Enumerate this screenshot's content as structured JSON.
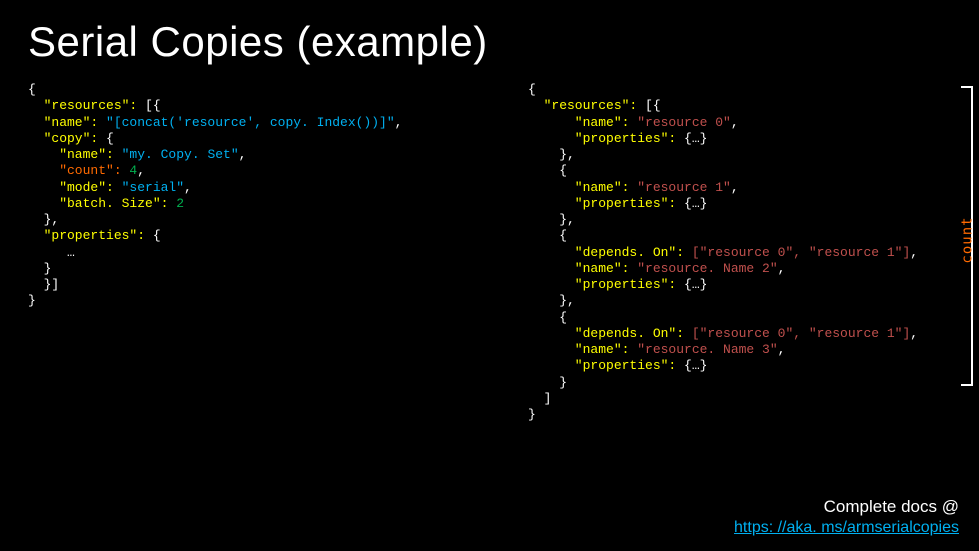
{
  "slide": {
    "title": "Serial Copies  (example)"
  },
  "code_left": {
    "l0": "{",
    "l1a": "  \"resources\": ",
    "l1b": "[{",
    "l2a": "  \"name\": ",
    "l2b": "\"[concat('resource', copy. Index())]\"",
    "l2c": ",",
    "l3a": "  \"copy\": ",
    "l3b": "{",
    "l4a": "    \"name\": ",
    "l4b": "\"my. Copy. Set\"",
    "l4c": ",",
    "l5a": "    \"count\": ",
    "l5b": "4",
    "l5c": ",",
    "l6a": "    \"mode\": ",
    "l6b": "\"serial\"",
    "l6c": ",",
    "l7a": "    \"batch. Size\": ",
    "l7b": "2",
    "l8": "  },",
    "l9a": "  \"properties\": ",
    "l9b": "{",
    "l10": "     …",
    "l11": "  }",
    "l12": "  }]",
    "l13": "}"
  },
  "code_right": {
    "l0": "{",
    "l1a": "  \"resources\": ",
    "l1b": "[{",
    "l2a": "      \"name\": ",
    "l2b": "\"resource 0\"",
    "l2c": ",",
    "l3a": "      \"properties\": ",
    "l3b": "{…}",
    "l4": "    },",
    "l5": "    {",
    "l6a": "      \"name\": ",
    "l6b": "\"resource 1\"",
    "l6c": ",",
    "l7a": "      \"properties\": ",
    "l7b": "{…}",
    "l8": "    },",
    "l9": "    {",
    "l10a": "      \"depends. On\": ",
    "l10b": "[\"resource 0\", \"resource 1\"]",
    "l10c": ",",
    "l11a": "      \"name\": ",
    "l11b": "\"resource. Name 2\"",
    "l11c": ",",
    "l12a": "      \"properties\": ",
    "l12b": "{…}",
    "l13": "    },",
    "l14": "    {",
    "l15a": "      \"depends. On\": ",
    "l15b": "[\"resource 0\", \"resource 1\"]",
    "l15c": ",",
    "l16a": "      \"name\": ",
    "l16b": "\"resource. Name 3\"",
    "l16c": ",",
    "l17a": "      \"properties\": ",
    "l17b": "{…}",
    "l18": "    }",
    "l19": "  ]",
    "l20": "}"
  },
  "annotation": {
    "count": "count"
  },
  "footer": {
    "text": "Complete docs @",
    "link": "https: //aka. ms/armserialcopies"
  }
}
